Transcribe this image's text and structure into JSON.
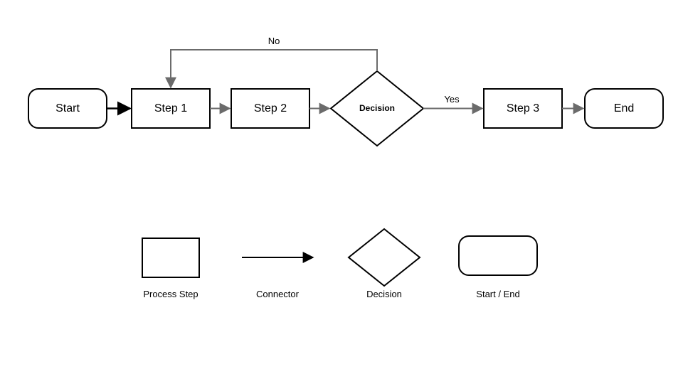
{
  "flow": {
    "nodes": {
      "start": {
        "label": "Start",
        "type": "terminator"
      },
      "step1": {
        "label": "Step 1",
        "type": "process"
      },
      "step2": {
        "label": "Step 2",
        "type": "process"
      },
      "decision": {
        "label": "Decision",
        "type": "decision"
      },
      "step3": {
        "label": "Step 3",
        "type": "process"
      },
      "end": {
        "label": "End",
        "type": "terminator"
      }
    },
    "edges": {
      "start_step1": {
        "from": "start",
        "to": "step1"
      },
      "step1_step2": {
        "from": "step1",
        "to": "step2"
      },
      "step2_decision": {
        "from": "step2",
        "to": "decision"
      },
      "decision_step3": {
        "from": "decision",
        "to": "step3",
        "label": "Yes"
      },
      "decision_step1": {
        "from": "decision",
        "to": "step1",
        "label": "No"
      },
      "step3_end": {
        "from": "step3",
        "to": "end"
      }
    }
  },
  "legend": {
    "process": "Process Step",
    "connector": "Connector",
    "decision": "Decision",
    "terminator": "Start / End"
  }
}
